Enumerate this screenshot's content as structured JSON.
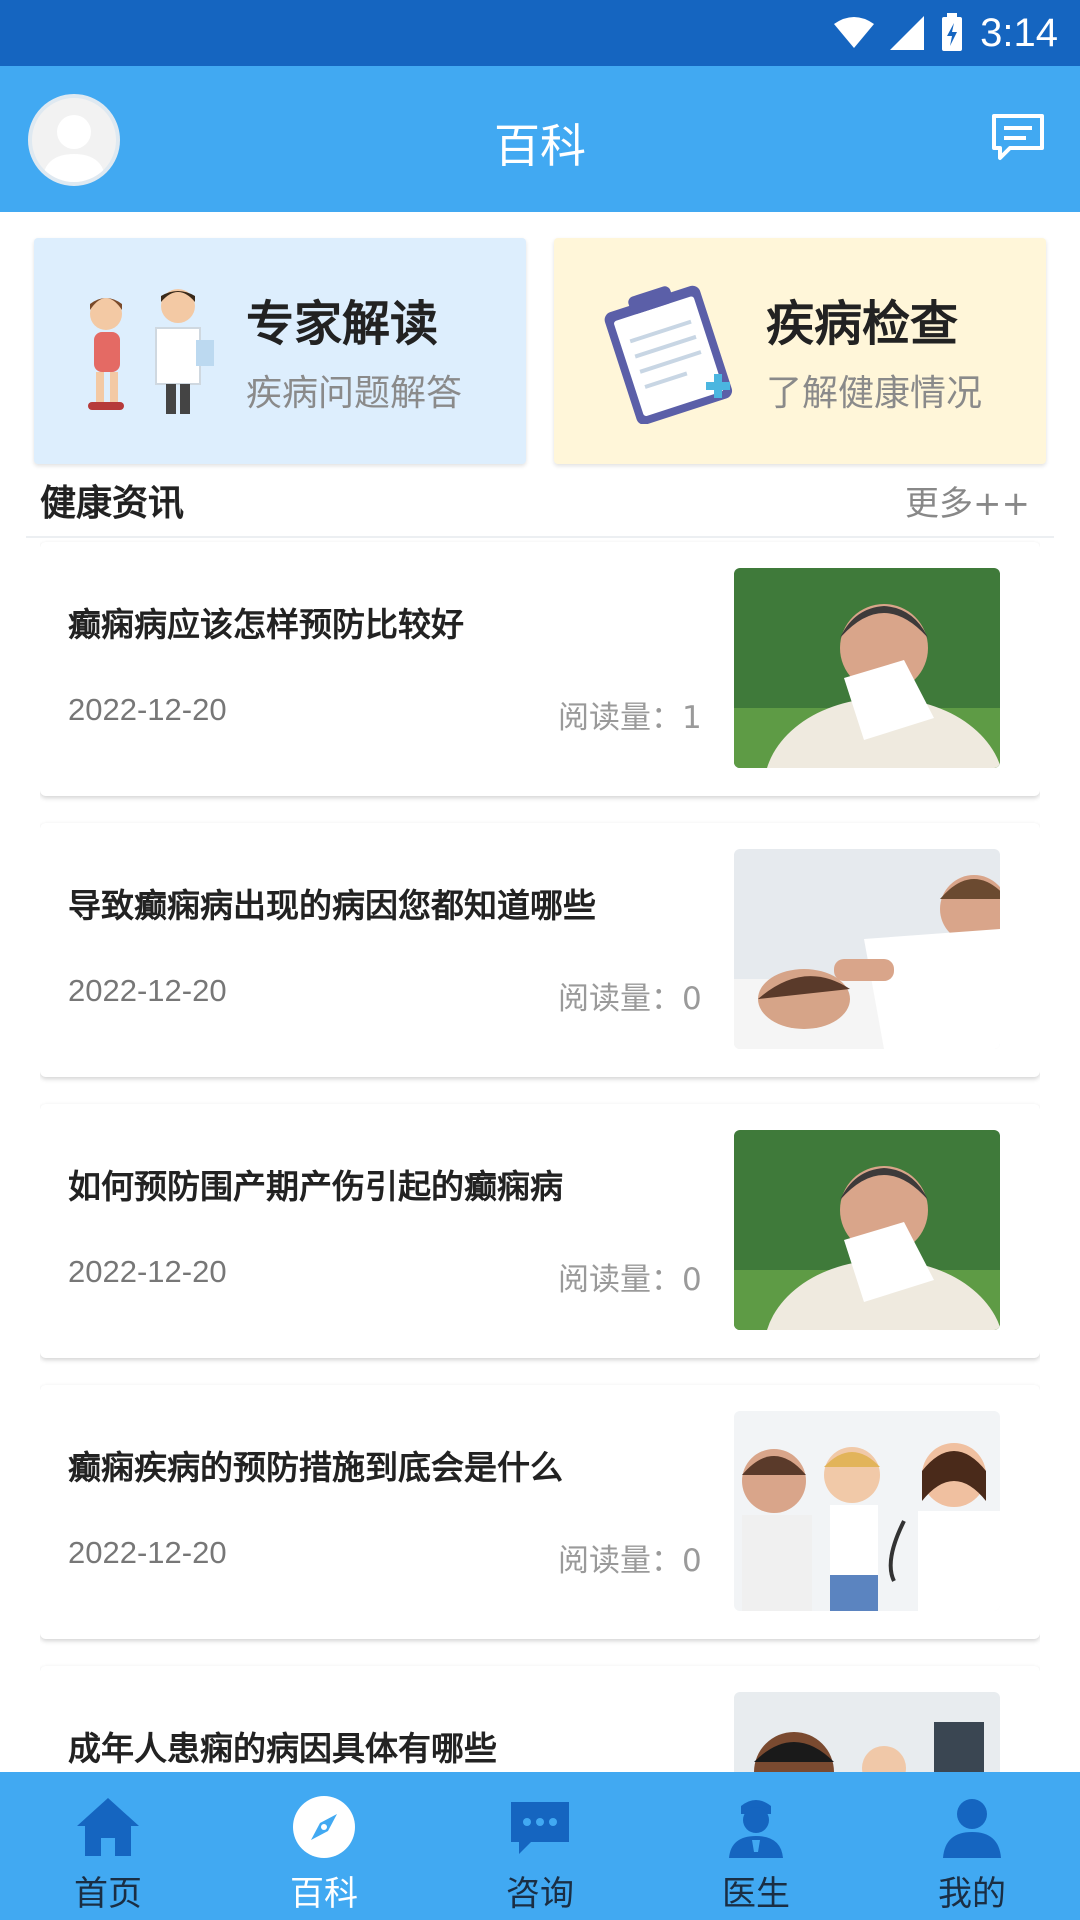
{
  "status_bar": {
    "time": "3:14"
  },
  "header": {
    "title": "百科"
  },
  "feature_cards": [
    {
      "title": "专家解读",
      "subtitle": "疾病问题解答"
    },
    {
      "title": "疾病检查",
      "subtitle": "了解健康情况"
    }
  ],
  "section": {
    "title": "健康资讯",
    "more": "更多++"
  },
  "articles": [
    {
      "title": "癫痫病应该怎样预防比较好",
      "date": "2022-12-20",
      "reads": "阅读量：1"
    },
    {
      "title": "导致癫痫病出现的病因您都知道哪些",
      "date": "2022-12-20",
      "reads": "阅读量：0"
    },
    {
      "title": "如何预防围产期产伤引起的癫痫病",
      "date": "2022-12-20",
      "reads": "阅读量：0"
    },
    {
      "title": "癫痫疾病的预防措施到底会是什么",
      "date": "2022-12-20",
      "reads": "阅读量：0"
    },
    {
      "title": "成年人患痫的病因具体有哪些",
      "date": "",
      "reads": ""
    }
  ],
  "tabs": [
    {
      "label": "首页",
      "icon": "home-icon"
    },
    {
      "label": "百科",
      "icon": "compass-icon",
      "active": true
    },
    {
      "label": "咨询",
      "icon": "chat-icon"
    },
    {
      "label": "医生",
      "icon": "doctor-icon"
    },
    {
      "label": "我的",
      "icon": "person-icon"
    }
  ],
  "colors": {
    "primary": "#41A9F2",
    "status_bar": "#1565C0",
    "expert_card": "#DDEEFD",
    "check_card": "#FFF6D9"
  }
}
